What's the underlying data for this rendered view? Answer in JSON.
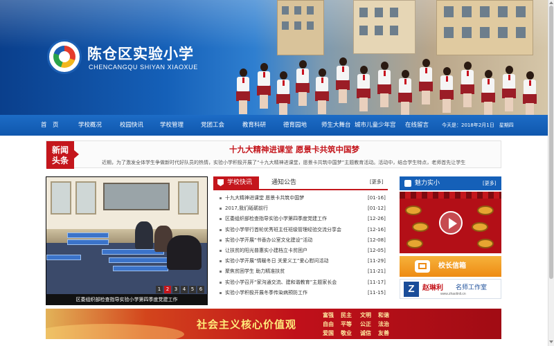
{
  "header": {
    "school_name": "陈仓区实验小学",
    "school_pinyin": "CHENCANGQU SHIYAN XIAOXUE",
    "emblem_text": "陈仓区实验小学"
  },
  "nav": {
    "items": [
      "首　页",
      "学校概况",
      "校园快讯",
      "学校管理",
      "党团工会",
      "教育科研",
      "德育园地",
      "师生大舞台",
      "城市儿童少年宫",
      "在线留言"
    ],
    "date_text": "今天是：2018年2月1日　星期四"
  },
  "headline_news": {
    "tag_line1": "新闻",
    "tag_line2": "头条",
    "title": "十九大精神进课堂 愿景卡共筑中国梦",
    "summary": "近期，为了激发全体学生争做新时代好队员的热情，实验小学积极开展了“十九大精神进课堂，愿景卡共筑中国梦”主题教育活动。活动中，结合学生特点，老师首先让学生"
  },
  "slideshow": {
    "pages": [
      "1",
      "2",
      "3",
      "4",
      "5",
      "6"
    ],
    "active_page": "2",
    "caption": "区委组织部检查指导实验小学第四季度党建工作"
  },
  "news_list": {
    "active_tab": "学校快讯",
    "other_tab": "通知公告",
    "more_label": "[更多]",
    "items": [
      {
        "title": "十九大精神进课堂 愿景卡共筑中国梦",
        "date": "[01-16]"
      },
      {
        "title": "2017,我们砥砺前行",
        "date": "[01-12]"
      },
      {
        "title": "区委组织部检查指导实验小学第四季度党建工作",
        "date": "[12-26]"
      },
      {
        "title": "实验小学举行首轮优秀班主任班级管理经验交流分享会",
        "date": "[12-16]"
      },
      {
        "title": "实验小学开展“书香办公室文化建设”活动",
        "date": "[12-08]"
      },
      {
        "title": "让扶贫的阳光普惠实小建档立卡贫困户",
        "date": "[12-05]"
      },
      {
        "title": "实验小学开展“情暖冬日 关爱义工”爱心慰问活动",
        "date": "[11-29]"
      },
      {
        "title": "聚焦贫困学生 助力精准扶贫",
        "date": "[11-21]"
      },
      {
        "title": "实验小学召开“家沟通交流、建和谐教育”主题家长会",
        "date": "[11-17]"
      },
      {
        "title": "实验小学积极开展冬季传染病预防工作",
        "date": "[11-15]"
      }
    ]
  },
  "sidebar": {
    "charm_title": "魅力实小",
    "charm_more": "[更多]",
    "principal_mailbox": "校长信箱",
    "studio_name": "赵琳利",
    "studio_suffix": "名师工作室",
    "studio_url": "www.zhaolinli.cn"
  },
  "values_banner": {
    "title": "社会主义核心价值观",
    "words": [
      "富强",
      "民主",
      "文明",
      "和谐",
      "自由",
      "平等",
      "公正",
      "法治",
      "爱国",
      "敬业",
      "诚信",
      "友善"
    ]
  },
  "colors": {
    "brand_blue": "#1560b8",
    "accent_red": "#c4161c",
    "mailbox_orange": "#ee8b14"
  }
}
